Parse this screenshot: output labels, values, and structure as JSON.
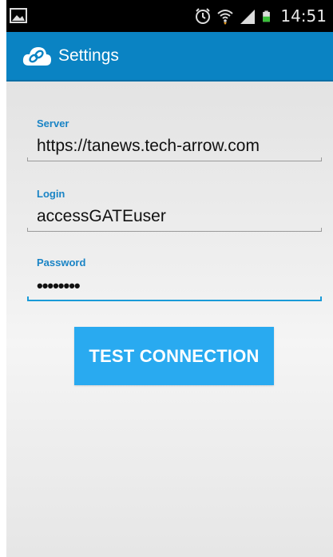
{
  "status_bar": {
    "time": "14:51",
    "icons": [
      "gallery-notification-icon",
      "alarm-icon",
      "wifi-icon",
      "signal-icon",
      "battery-icon"
    ]
  },
  "action_bar": {
    "title": "Settings",
    "logo_icon": "cloud-link-logo-icon",
    "background_color": "#0a83c3"
  },
  "form": {
    "server": {
      "label": "Server",
      "value": "https://tanews.tech-arrow.com"
    },
    "login": {
      "label": "Login",
      "value": "accessGATEuser"
    },
    "password": {
      "label": "Password",
      "value": "••••••••",
      "focused": true
    }
  },
  "test_button": {
    "label": "TEST CONNECTION",
    "color": "#29aaf0"
  },
  "colors": {
    "label_blue": "#1a84c5",
    "focus_line": "#1a9bd8"
  }
}
